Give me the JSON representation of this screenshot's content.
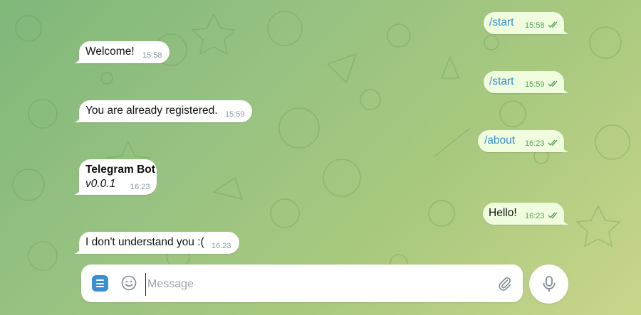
{
  "messages": [
    {
      "dir": "out",
      "text": "/start",
      "time": "15:58"
    },
    {
      "dir": "in",
      "text": "Welcome!",
      "time": "15:58"
    },
    {
      "dir": "out",
      "text": "/start",
      "time": "15:59"
    },
    {
      "dir": "in",
      "text": "You are already registered.",
      "time": "15:59"
    },
    {
      "dir": "out",
      "text": "/about",
      "time": "16:23"
    },
    {
      "dir": "in",
      "title": "Telegram Bot",
      "subtitle": "v0.0.1",
      "time": "16:23"
    },
    {
      "dir": "out",
      "text": "Hello!",
      "time": "16:23"
    },
    {
      "dir": "in",
      "text": "I don't understand you :(",
      "time": "16:23"
    }
  ],
  "composer": {
    "placeholder": "Message",
    "value": "",
    "icons": {
      "menu": "menu-icon",
      "emoji": "emoji-icon",
      "attach": "paperclip-icon",
      "send": "microphone-icon"
    }
  },
  "colors": {
    "accent": "#3a8fd1",
    "incoming_bubble": "#ffffff",
    "outgoing_bubble": "#effdde",
    "read_checks": "#5ea05a"
  }
}
